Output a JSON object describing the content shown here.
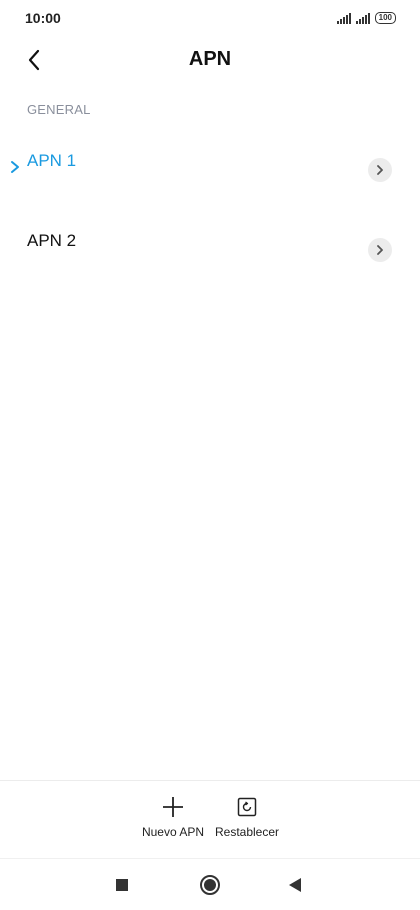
{
  "status": {
    "time": "10:00",
    "battery": "100"
  },
  "header": {
    "title": "APN"
  },
  "section": {
    "label": "GENERAL"
  },
  "apns": [
    {
      "name": "APN 1",
      "selected": true
    },
    {
      "name": "APN 2",
      "selected": false
    }
  ],
  "actions": {
    "new_label": "Nuevo APN",
    "reset_label": "Restablecer"
  },
  "colors": {
    "accent": "#1a9ae0",
    "section_label": "#8a8f9c"
  },
  "icons": {
    "back": "chevron-left-icon",
    "selected": "chevron-right-icon",
    "item_arrow": "chevron-right-icon",
    "new": "plus-icon",
    "reset": "reset-icon",
    "nav_recents": "square-icon",
    "nav_home": "circle-icon",
    "nav_back": "triangle-left-icon"
  }
}
